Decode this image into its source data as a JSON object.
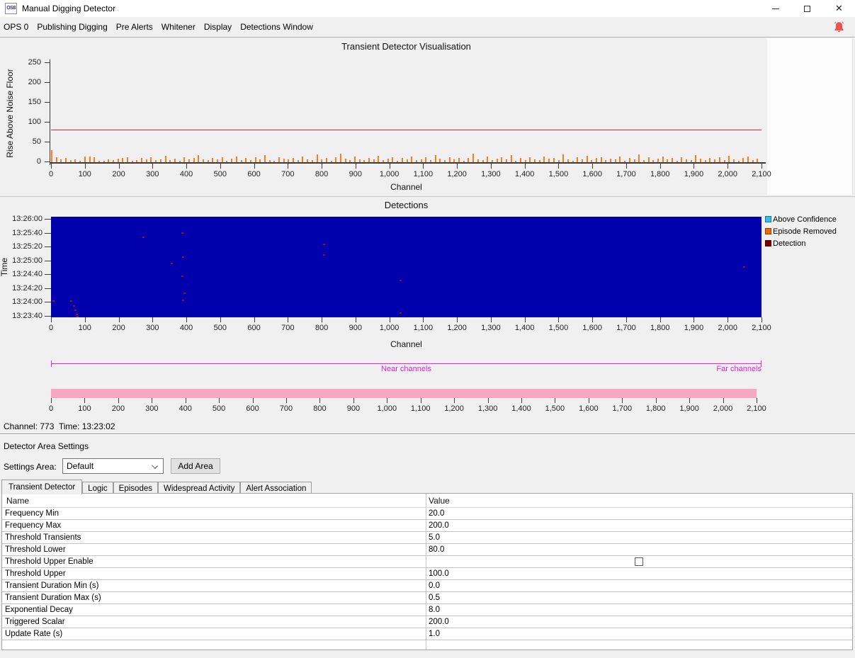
{
  "window": {
    "title": "Manual Digging Detector",
    "icon_text": "OS8",
    "controls": {
      "minimize": "minimize",
      "maximize": "maximize",
      "close": "close"
    }
  },
  "menu": {
    "items": [
      "OPS 0",
      "Publishing Digging",
      "Pre Alerts",
      "Whitener",
      "Display",
      "Detections Window"
    ]
  },
  "status": {
    "text": "Channel: 773  Time: 13:23:02"
  },
  "chart_data": [
    {
      "type": "bar",
      "title": "Transient Detector Visualisation",
      "xlabel": "Channel",
      "ylabel": "Rise Above Noise Floor",
      "xlim": [
        0,
        2100
      ],
      "ylim": [
        0,
        250
      ],
      "x_ticks": [
        0,
        100,
        200,
        300,
        400,
        500,
        600,
        700,
        800,
        900,
        1000,
        1100,
        1200,
        1300,
        1400,
        1500,
        1600,
        1700,
        1800,
        1900,
        2000,
        2100
      ],
      "y_ticks": [
        0,
        50,
        100,
        150,
        200,
        250
      ],
      "threshold_line": {
        "value": 80,
        "color": "#cc2b2b"
      },
      "bar_color": "#fd7d1e",
      "bars": [
        30,
        12,
        7,
        10,
        5,
        8,
        4,
        14,
        15,
        13,
        4,
        3,
        7,
        5,
        9,
        11,
        12,
        4,
        6,
        10,
        8,
        13,
        5,
        7,
        16,
        6,
        9,
        4,
        12,
        7,
        10,
        18,
        8,
        5,
        11,
        7,
        13,
        4,
        9,
        15,
        6,
        10,
        5,
        12,
        8,
        17,
        6,
        4,
        13,
        9,
        7,
        11,
        5,
        14,
        8,
        6,
        19,
        7,
        10,
        4,
        12,
        22,
        9,
        6,
        14,
        8,
        5,
        11,
        7,
        16,
        6,
        9,
        13,
        4,
        10,
        7,
        15,
        5,
        8,
        12,
        6,
        18,
        9,
        5,
        13,
        7,
        10,
        4,
        11,
        21,
        8,
        6,
        14,
        5,
        9,
        12,
        7,
        17,
        4,
        10,
        6,
        13,
        8,
        5,
        15,
        9,
        11,
        6,
        19,
        7,
        4,
        12,
        8,
        16,
        5,
        10,
        13,
        6,
        9,
        7,
        14,
        4,
        11,
        8,
        20,
        6,
        12,
        5,
        9,
        15,
        7,
        10,
        4,
        13,
        8,
        6,
        17,
        9,
        5,
        11,
        7,
        12,
        6,
        16,
        8,
        4,
        10,
        14,
        5,
        9
      ]
    },
    {
      "type": "heatmap",
      "title": "Detections",
      "xlabel": "Channel",
      "ylabel": "Time",
      "xlim": [
        0,
        2100
      ],
      "x_ticks": [
        0,
        100,
        200,
        300,
        400,
        500,
        600,
        700,
        800,
        900,
        1000,
        1100,
        1200,
        1300,
        1400,
        1500,
        1600,
        1700,
        1800,
        1900,
        2000,
        2100
      ],
      "y_ticks": [
        "13:26:00",
        "13:25:40",
        "13:25:20",
        "13:25:00",
        "13:24:40",
        "13:24:20",
        "13:24:00",
        "13:23:40"
      ],
      "base_color": "#0000ad",
      "mark_color": "#a21015",
      "legend": [
        {
          "label": "Above Confidence",
          "color": "#2fc1ee"
        },
        {
          "label": "Episode Removed",
          "color": "#f2690d"
        },
        {
          "label": "Detection",
          "color": "#780000"
        }
      ],
      "detections": [
        {
          "channel": 272,
          "time": "13:25:35"
        },
        {
          "channel": 387,
          "time": "13:25:41"
        },
        {
          "channel": 389,
          "time": "13:25:06"
        },
        {
          "channel": 356,
          "time": "13:24:57"
        },
        {
          "channel": 387,
          "time": "13:24:38"
        },
        {
          "channel": 394,
          "time": "13:24:14"
        },
        {
          "channel": 389,
          "time": "13:24:04"
        },
        {
          "channel": 6,
          "time": "13:24:03"
        },
        {
          "channel": 59,
          "time": "13:24:03"
        },
        {
          "channel": 67,
          "time": "13:23:55"
        },
        {
          "channel": 71,
          "time": "13:23:49"
        },
        {
          "channel": 75,
          "time": "13:23:43"
        },
        {
          "channel": 77,
          "time": "13:23:40"
        },
        {
          "channel": 806,
          "time": "13:25:24"
        },
        {
          "channel": 806,
          "time": "13:25:09"
        },
        {
          "channel": 1032,
          "time": "13:24:32"
        },
        {
          "channel": 1032,
          "time": "13:23:45"
        },
        {
          "channel": 2047,
          "time": "13:24:52"
        }
      ]
    },
    {
      "type": "minimap",
      "near_label": "Near channels",
      "far_label": "Far channels",
      "line_color": "#ea1fea",
      "bar_color": "#f8a6c2",
      "x_ticks": [
        0,
        100,
        200,
        300,
        400,
        500,
        600,
        700,
        800,
        900,
        1000,
        1100,
        1200,
        1300,
        1400,
        1500,
        1600,
        1700,
        1800,
        1900,
        2000,
        2100
      ]
    }
  ],
  "settings": {
    "section_title": "Detector Area Settings",
    "area_label": "Settings Area:",
    "area_value": "Default",
    "add_button_label": "Add Area",
    "tabs": [
      "Transient Detector",
      "Logic",
      "Episodes",
      "Widespread Activity",
      "Alert Association"
    ],
    "active_tab": "Transient Detector",
    "table": {
      "columns": [
        "Name",
        "Value"
      ],
      "rows": [
        {
          "name": "Frequency Min",
          "value": "20.0"
        },
        {
          "name": "Frequency Max",
          "value": "200.0"
        },
        {
          "name": "Threshold Transients",
          "value": "5.0"
        },
        {
          "name": "Threshold Lower",
          "value": "80.0"
        },
        {
          "name": "Threshold Upper Enable",
          "value": "",
          "checkbox": true,
          "checked": false
        },
        {
          "name": "Threshold Upper",
          "value": "100.0"
        },
        {
          "name": "Transient Duration Min (s)",
          "value": "0.0"
        },
        {
          "name": "Transient Duration Max (s)",
          "value": "0.5"
        },
        {
          "name": "Exponential Decay",
          "value": "8.0"
        },
        {
          "name": "Triggered Scalar",
          "value": "200.0"
        },
        {
          "name": "Update Rate (s)",
          "value": "1.0"
        }
      ]
    }
  }
}
